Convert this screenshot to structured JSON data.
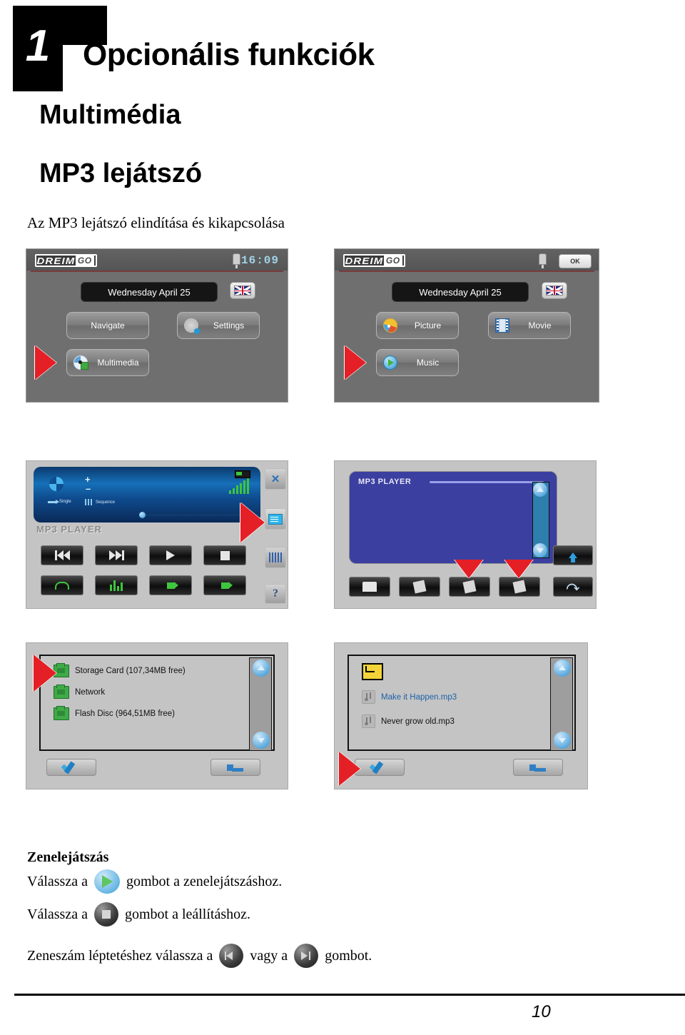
{
  "header": {
    "chapter_number": "1",
    "title": "Opcionális funkciók",
    "subtitle_1": "Multimédia",
    "subtitle_2": "MP3 lejátszó",
    "lead": "Az MP3 lejátszó elindítása és kikapcsolása"
  },
  "screen_main_menu": {
    "logo_part1": "DREIM",
    "logo_part2": "GO",
    "clock": "16:09",
    "date": "Wednesday April 25",
    "buttons": [
      {
        "label": "Navigate",
        "icon": "none"
      },
      {
        "label": "Settings",
        "icon": "gear-icon"
      },
      {
        "label": "Multimedia",
        "icon": "disc-icon"
      }
    ]
  },
  "screen_multimedia_menu": {
    "logo_part1": "DREIM",
    "logo_part2": "GO",
    "ok_label": "OK",
    "date": "Wednesday April 25",
    "buttons": [
      {
        "label": "Picture",
        "icon": "palette-icon"
      },
      {
        "label": "Movie",
        "icon": "film-icon"
      },
      {
        "label": "Music",
        "icon": "play-icon"
      }
    ]
  },
  "screen_mp3_player": {
    "title": "MP3 PLAYER",
    "mode_single": "Single",
    "mode_sequence": "Sequence",
    "eq_levels": [
      4,
      7,
      10,
      13,
      16,
      20
    ],
    "progress_percent": 12,
    "transport_buttons": [
      {
        "name": "previous-track-button"
      },
      {
        "name": "next-track-button"
      },
      {
        "name": "play-button"
      },
      {
        "name": "stop-button"
      }
    ],
    "secondary_buttons": [
      {
        "name": "repeat-button"
      },
      {
        "name": "equalizer-button"
      },
      {
        "name": "volume-down-button"
      },
      {
        "name": "volume-up-button"
      }
    ],
    "side_buttons": [
      {
        "name": "close-button"
      },
      {
        "name": "playlist-button"
      },
      {
        "name": "list-view-button"
      },
      {
        "name": "help-button"
      }
    ]
  },
  "screen_playlist": {
    "title": "MP3 PLAYER",
    "bottom_buttons": [
      {
        "name": "open-folder-button"
      },
      {
        "name": "save-list-button"
      },
      {
        "name": "add-track-button"
      },
      {
        "name": "remove-track-button"
      }
    ],
    "side_buttons": [
      {
        "name": "move-up-button"
      },
      {
        "name": "back-button"
      }
    ]
  },
  "screen_storage_browser": {
    "items": [
      {
        "label": "Storage Card (107,34MB free)",
        "icon": "network-drive-icon"
      },
      {
        "label": "Network",
        "icon": "network-drive-icon"
      },
      {
        "label": "Flash Disc (964,51MB free)",
        "icon": "network-drive-icon"
      }
    ],
    "confirm_button": "ok-check-button",
    "back_button": "return-button"
  },
  "screen_file_browser": {
    "items": [
      {
        "label": "",
        "icon": "parent-folder-icon",
        "selected": false
      },
      {
        "label": "Make it Happen.mp3",
        "icon": "music-note-icon",
        "selected": true
      },
      {
        "label": "Never grow old.mp3",
        "icon": "music-note-icon",
        "selected": false
      }
    ],
    "confirm_button": "ok-check-button",
    "back_button": "return-button"
  },
  "instructions": {
    "heading": "Zenelejátszás",
    "line1_before": "Válassza a",
    "line1_after": "gombot a zenelejátszáshoz.",
    "line2_before": "Válassza a",
    "line2_after": "gombot a leállításhoz.",
    "line3_before": "Zeneszám léptetéshez válassza a",
    "line3_middle": "vagy a",
    "line3_after": "gombot."
  },
  "footer": {
    "page_number": "10"
  },
  "colors": {
    "accent_red": "#e41f26",
    "device_gray": "#6f6f6f",
    "lcd_blue": "#1670b8",
    "playlist_blue": "#3b3fa0"
  }
}
